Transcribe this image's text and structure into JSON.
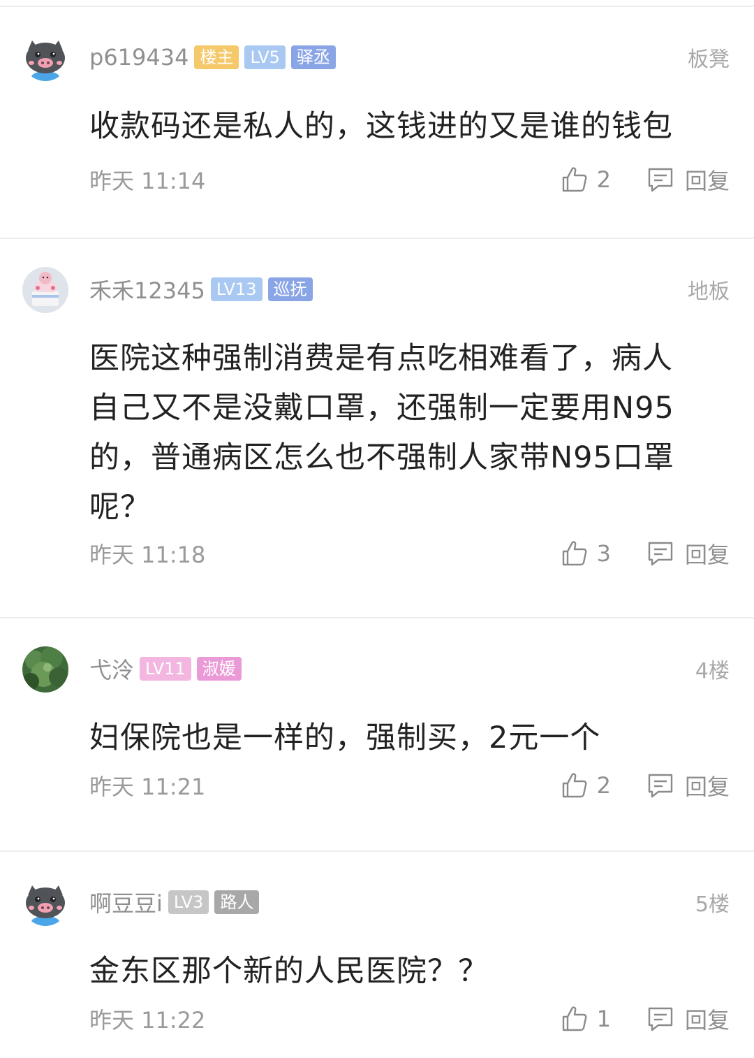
{
  "comments": [
    {
      "username": "p619434",
      "badges": [
        {
          "text": "楼主",
          "color": "#f5c86a"
        },
        {
          "text": "LV5",
          "color": "#a9c8f2"
        },
        {
          "text": "驿丞",
          "color": "#8aa5e6"
        }
      ],
      "floor": "板凳",
      "text": "收款码还是私人的，这钱进的又是谁的钱包",
      "time": "昨天 11:14",
      "likes": "2",
      "reply_label": "回复",
      "avatar": "pig-avatar"
    },
    {
      "username": "禾禾12345",
      "badges": [
        {
          "text": "LV13",
          "color": "#a9c8f2"
        },
        {
          "text": "巡抚",
          "color": "#8aa5e6"
        }
      ],
      "floor": "地板",
      "text": "医院这种强制消费是有点吃相难看了，病人自己又不是没戴口罩，还强制一定要用N95的，普通病区怎么也不强制人家带N95口罩呢？",
      "time": "昨天 11:18",
      "likes": "3",
      "reply_label": "回复",
      "avatar": "cake-photo-avatar"
    },
    {
      "username": "弋泠",
      "badges": [
        {
          "text": "LV11",
          "color": "#f2b6e1"
        },
        {
          "text": "淑媛",
          "color": "#ea9ad6"
        }
      ],
      "floor": "4楼",
      "text": "妇保院也是一样的，强制买，2元一个",
      "time": "昨天 11:21",
      "likes": "2",
      "reply_label": "回复",
      "avatar": "tree-photo-avatar"
    },
    {
      "username": "啊豆豆i",
      "badges": [
        {
          "text": "LV3",
          "color": "#c6c6c6"
        },
        {
          "text": "路人",
          "color": "#a8a8a8"
        }
      ],
      "floor": "5楼",
      "text": "金东区那个新的人民医院？？",
      "time": "昨天 11:22",
      "likes": "1",
      "reply_label": "回复",
      "avatar": "pig-avatar"
    }
  ]
}
